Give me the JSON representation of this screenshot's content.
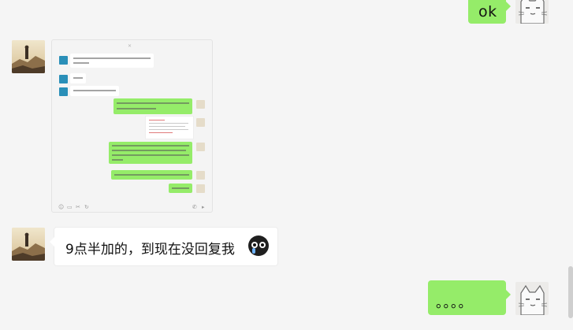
{
  "messages": {
    "top_ok": "ok",
    "late_reply": "9点半加的，到现在没回复我",
    "dots": "。。。。"
  },
  "screenshot_card": {
    "header": "✕"
  },
  "colors": {
    "sent_bubble": "#95ec69",
    "received_bubble": "#ffffff",
    "background": "#f5f5f5"
  },
  "icons": {
    "emoji": "crying-face-emoji",
    "avatar_self": "cat-avatar",
    "avatar_other": "cliff-landscape-avatar"
  }
}
